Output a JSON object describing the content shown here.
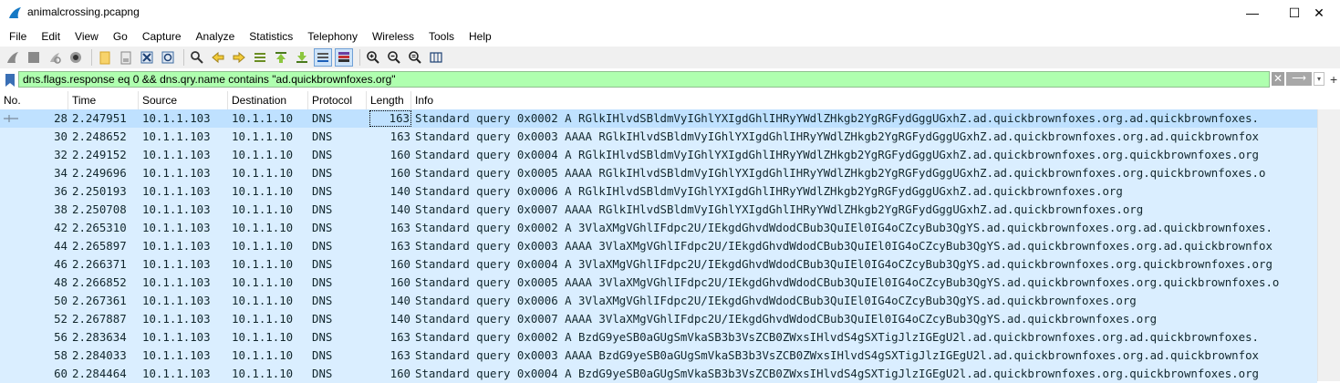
{
  "window": {
    "title": "animalcrossing.pcapng",
    "minimize": "—",
    "maximize": "☐",
    "close": "✕"
  },
  "menu": [
    "File",
    "Edit",
    "View",
    "Go",
    "Capture",
    "Analyze",
    "Statistics",
    "Telephony",
    "Wireless",
    "Tools",
    "Help"
  ],
  "toolbar": {
    "icons": [
      "shark-fin-start-icon",
      "stop-capture-icon",
      "restart-capture-icon",
      "capture-options-icon",
      "open-file-icon",
      "save-file-icon",
      "close-file-icon",
      "reload-file-icon",
      "find-packet-icon",
      "go-back-icon",
      "go-forward-icon",
      "go-to-packet-icon",
      "go-first-icon",
      "go-last-icon",
      "auto-scroll-icon",
      "colorize-icon",
      "zoom-in-icon",
      "zoom-out-icon",
      "zoom-normal-icon",
      "resize-columns-icon"
    ]
  },
  "filter": {
    "value": "dns.flags.response eq 0 && dns.qry.name contains \"ad.quickbrownfoxes.org\"",
    "clear": "✕",
    "apply": "⟶",
    "dropdown": "▾",
    "add": "+",
    "color": "#afffaf"
  },
  "columns": {
    "no": "No.",
    "time": "Time",
    "source": "Source",
    "destination": "Destination",
    "protocol": "Protocol",
    "length": "Length",
    "info": "Info"
  },
  "packets": [
    {
      "no": "28",
      "time": "2.247951",
      "src": "10.1.1.103",
      "dst": "10.1.1.10",
      "proto": "DNS",
      "len": "163",
      "info": "Standard query 0x0002 A RGlkIHlvdSBldmVyIGhlYXIgdGhlIHRyYWdlZHkgb2YgRGFydGggUGxhZ.ad.quickbrownfoxes.org.ad.quickbrownfoxes."
    },
    {
      "no": "30",
      "time": "2.248652",
      "src": "10.1.1.103",
      "dst": "10.1.1.10",
      "proto": "DNS",
      "len": "163",
      "info": "Standard query 0x0003 AAAA RGlkIHlvdSBldmVyIGhlYXIgdGhlIHRyYWdlZHkgb2YgRGFydGggUGxhZ.ad.quickbrownfoxes.org.ad.quickbrownfox"
    },
    {
      "no": "32",
      "time": "2.249152",
      "src": "10.1.1.103",
      "dst": "10.1.1.10",
      "proto": "DNS",
      "len": "160",
      "info": "Standard query 0x0004 A RGlkIHlvdSBldmVyIGhlYXIgdGhlIHRyYWdlZHkgb2YgRGFydGggUGxhZ.ad.quickbrownfoxes.org.quickbrownfoxes.org"
    },
    {
      "no": "34",
      "time": "2.249696",
      "src": "10.1.1.103",
      "dst": "10.1.1.10",
      "proto": "DNS",
      "len": "160",
      "info": "Standard query 0x0005 AAAA RGlkIHlvdSBldmVyIGhlYXIgdGhlIHRyYWdlZHkgb2YgRGFydGggUGxhZ.ad.quickbrownfoxes.org.quickbrownfoxes.o"
    },
    {
      "no": "36",
      "time": "2.250193",
      "src": "10.1.1.103",
      "dst": "10.1.1.10",
      "proto": "DNS",
      "len": "140",
      "info": "Standard query 0x0006 A RGlkIHlvdSBldmVyIGhlYXIgdGhlIHRyYWdlZHkgb2YgRGFydGggUGxhZ.ad.quickbrownfoxes.org"
    },
    {
      "no": "38",
      "time": "2.250708",
      "src": "10.1.1.103",
      "dst": "10.1.1.10",
      "proto": "DNS",
      "len": "140",
      "info": "Standard query 0x0007 AAAA RGlkIHlvdSBldmVyIGhlYXIgdGhlIHRyYWdlZHkgb2YgRGFydGggUGxhZ.ad.quickbrownfoxes.org"
    },
    {
      "no": "42",
      "time": "2.265310",
      "src": "10.1.1.103",
      "dst": "10.1.1.10",
      "proto": "DNS",
      "len": "163",
      "info": "Standard query 0x0002 A 3VlaXMgVGhlIFdpc2U/IEkgdGhvdWdodCBub3QuIEl0IG4oCZcyBub3QgYS.ad.quickbrownfoxes.org.ad.quickbrownfoxes."
    },
    {
      "no": "44",
      "time": "2.265897",
      "src": "10.1.1.103",
      "dst": "10.1.1.10",
      "proto": "DNS",
      "len": "163",
      "info": "Standard query 0x0003 AAAA 3VlaXMgVGhlIFdpc2U/IEkgdGhvdWdodCBub3QuIEl0IG4oCZcyBub3QgYS.ad.quickbrownfoxes.org.ad.quickbrownfox"
    },
    {
      "no": "46",
      "time": "2.266371",
      "src": "10.1.1.103",
      "dst": "10.1.1.10",
      "proto": "DNS",
      "len": "160",
      "info": "Standard query 0x0004 A 3VlaXMgVGhlIFdpc2U/IEkgdGhvdWdodCBub3QuIEl0IG4oCZcyBub3QgYS.ad.quickbrownfoxes.org.quickbrownfoxes.org"
    },
    {
      "no": "48",
      "time": "2.266852",
      "src": "10.1.1.103",
      "dst": "10.1.1.10",
      "proto": "DNS",
      "len": "160",
      "info": "Standard query 0x0005 AAAA 3VlaXMgVGhlIFdpc2U/IEkgdGhvdWdodCBub3QuIEl0IG4oCZcyBub3QgYS.ad.quickbrownfoxes.org.quickbrownfoxes.o"
    },
    {
      "no": "50",
      "time": "2.267361",
      "src": "10.1.1.103",
      "dst": "10.1.1.10",
      "proto": "DNS",
      "len": "140",
      "info": "Standard query 0x0006 A 3VlaXMgVGhlIFdpc2U/IEkgdGhvdWdodCBub3QuIEl0IG4oCZcyBub3QgYS.ad.quickbrownfoxes.org"
    },
    {
      "no": "52",
      "time": "2.267887",
      "src": "10.1.1.103",
      "dst": "10.1.1.10",
      "proto": "DNS",
      "len": "140",
      "info": "Standard query 0x0007 AAAA 3VlaXMgVGhlIFdpc2U/IEkgdGhvdWdodCBub3QuIEl0IG4oCZcyBub3QgYS.ad.quickbrownfoxes.org"
    },
    {
      "no": "56",
      "time": "2.283634",
      "src": "10.1.1.103",
      "dst": "10.1.1.10",
      "proto": "DNS",
      "len": "163",
      "info": "Standard query 0x0002 A BzdG9yeSB0aGUgSmVkaSB3b3VsZCB0ZWxsIHlvdS4gSXTigJlzIGEgU2l.ad.quickbrownfoxes.org.ad.quickbrownfoxes."
    },
    {
      "no": "58",
      "time": "2.284033",
      "src": "10.1.1.103",
      "dst": "10.1.1.10",
      "proto": "DNS",
      "len": "163",
      "info": "Standard query 0x0003 AAAA BzdG9yeSB0aGUgSmVkaSB3b3VsZCB0ZWxsIHlvdS4gSXTigJlzIGEgU2l.ad.quickbrownfoxes.org.ad.quickbrownfox"
    },
    {
      "no": "60",
      "time": "2.284464",
      "src": "10.1.1.103",
      "dst": "10.1.1.10",
      "proto": "DNS",
      "len": "160",
      "info": "Standard query 0x0004 A BzdG9yeSB0aGUgSmVkaSB3b3VsZCB0ZWxsIHlvdS4gSXTigJlzIGEgU2l.ad.quickbrownfoxes.org.quickbrownfoxes.org"
    }
  ],
  "selected_row_index": 0,
  "colors": {
    "row_bg": "#daeeff",
    "selected_row_bg": "#bfe1ff",
    "row_text": "#12272e",
    "filter_valid": "#afffaf"
  }
}
